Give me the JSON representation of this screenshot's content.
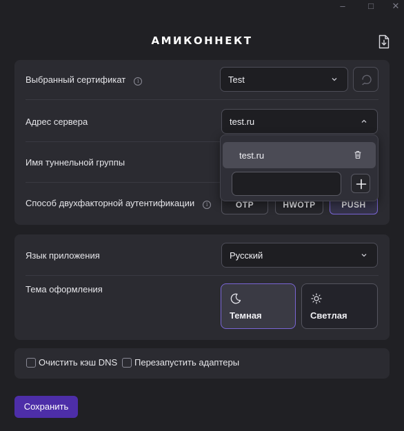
{
  "app": {
    "title": "АМИКОННЕКТ"
  },
  "window_controls": {
    "minimize": "–",
    "maximize": "□",
    "close": "✕"
  },
  "connection": {
    "certificate": {
      "label": "Выбранный сертификат",
      "value": "Test"
    },
    "server": {
      "label": "Адрес сервера",
      "value": "test.ru"
    },
    "tunnel_group": {
      "label": "Имя туннельной группы"
    },
    "two_factor": {
      "label": "Способ двухфакторной аутентификации",
      "options": [
        "OTP",
        "HWOTP",
        "PUSH"
      ],
      "selected": "PUSH"
    }
  },
  "server_dropdown": {
    "items": [
      "test.ru"
    ],
    "new_value": ""
  },
  "preferences": {
    "language": {
      "label": "Язык приложения",
      "value": "Русский"
    },
    "theme": {
      "label": "Тема оформления",
      "options": [
        "Темная",
        "Светлая"
      ],
      "selected": "Темная"
    }
  },
  "options": {
    "clear_dns": {
      "label": "Очистить кэш DNS",
      "checked": false
    },
    "restart_adapters": {
      "label": "Перезапустить адаптеры",
      "checked": false
    }
  },
  "actions": {
    "save_label": "Сохранить"
  },
  "colors": {
    "background": "#202024",
    "card": "#2b2b31",
    "accent": "#7a66d6",
    "save_button": "#4d2ea8"
  },
  "icons": [
    "info-icon",
    "chevron-down-icon",
    "chevron-up-icon",
    "refresh-icon",
    "export-icon",
    "trash-icon",
    "plus-icon",
    "moon-icon",
    "sun-icon"
  ]
}
